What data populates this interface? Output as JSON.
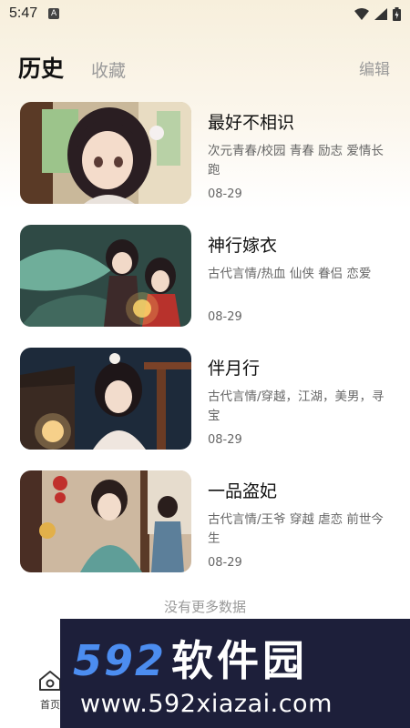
{
  "status_bar": {
    "time": "5:47",
    "notif_icon": "A"
  },
  "tabs": {
    "history": "历史",
    "favorites": "收藏",
    "edit": "编辑"
  },
  "items": [
    {
      "title": "最好不相识",
      "tags": "次元青春/校园 青春 励志 爱情长跑",
      "date": "08-29"
    },
    {
      "title": "神行嫁衣",
      "tags": "古代言情/热血 仙侠 眷侣 恋爱",
      "date": "08-29"
    },
    {
      "title": "伴月行",
      "tags": "古代言情/穿越，江湖，美男，寻宝",
      "date": "08-29"
    },
    {
      "title": "一品盗妃",
      "tags": "古代言情/王爷 穿越 虐恋 前世今生",
      "date": "08-29"
    }
  ],
  "footer_text": "没有更多数据",
  "nav": {
    "home": "首页"
  },
  "watermark": {
    "number": "592",
    "brand": "软件园",
    "url": "www.592xiazai.com"
  },
  "colors": {
    "accent_gold": "#f0c98c",
    "watermark_bg": "#1d1f3a",
    "watermark_blue": "#4c8df0"
  }
}
